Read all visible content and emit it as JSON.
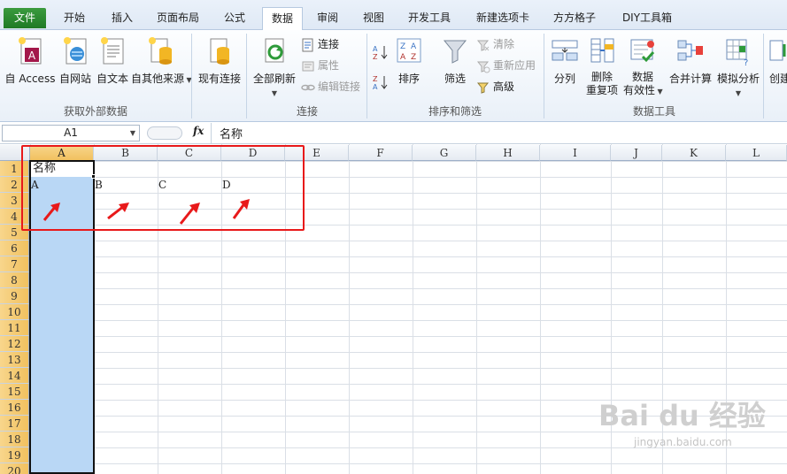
{
  "tabs": [
    {
      "label": "文件",
      "kind": "file"
    },
    {
      "label": "开始"
    },
    {
      "label": "插入"
    },
    {
      "label": "页面布局"
    },
    {
      "label": "公式"
    },
    {
      "label": "数据",
      "active": true
    },
    {
      "label": "审阅"
    },
    {
      "label": "视图"
    },
    {
      "label": "开发工具"
    },
    {
      "label": "新建选项卡"
    },
    {
      "label": "方方格子"
    },
    {
      "label": "DIY工具箱"
    }
  ],
  "ribbon": {
    "get_external": {
      "title": "获取外部数据",
      "access": "自 Access",
      "web": "自网站",
      "text": "自文本",
      "other": "自其他来源"
    },
    "existing": "现有连接",
    "connections": {
      "title": "连接",
      "refresh_all": "全部刷新",
      "connections": "连接",
      "properties": "属性",
      "edit_links": "编辑链接"
    },
    "sort_filter": {
      "title": "排序和筛选",
      "sort": "排序",
      "filter": "筛选",
      "clear": "清除",
      "reapply": "重新应用",
      "advanced": "高级"
    },
    "data_tools": {
      "title": "数据工具",
      "text_to_columns": "分列",
      "remove_dup_1": "删除",
      "remove_dup_2": "重复项",
      "validation_1": "数据",
      "validation_2": "有效性",
      "consolidate": "合并计算",
      "what_if": "模拟分析"
    },
    "outline": {
      "create": "创建"
    }
  },
  "formula_bar": {
    "name_box": "A1",
    "fx": "fx",
    "content": "名称"
  },
  "grid": {
    "columns": [
      "A",
      "B",
      "C",
      "D",
      "E",
      "F",
      "G",
      "H",
      "I",
      "J",
      "K",
      "L"
    ],
    "rows": [
      "1",
      "2",
      "3",
      "4",
      "5",
      "6",
      "7",
      "8",
      "9",
      "10",
      "11",
      "12",
      "13",
      "14",
      "15",
      "16",
      "17",
      "18",
      "19",
      "20"
    ],
    "cells": [
      {
        "ref": "A1",
        "value": "名称"
      },
      {
        "ref": "A2",
        "value": "A"
      },
      {
        "ref": "B2",
        "value": "B"
      },
      {
        "ref": "C2",
        "value": "C"
      },
      {
        "ref": "D2",
        "value": "D"
      }
    ],
    "selected_column": "A"
  },
  "watermark": {
    "brand": "Bai du 经验",
    "url": "jingyan.baidu.com"
  },
  "colors": {
    "file_tab": "#2e8b34",
    "highlight": "#e8191a",
    "selection": "#b9d7f5",
    "header_selected": "#f1c15f"
  }
}
